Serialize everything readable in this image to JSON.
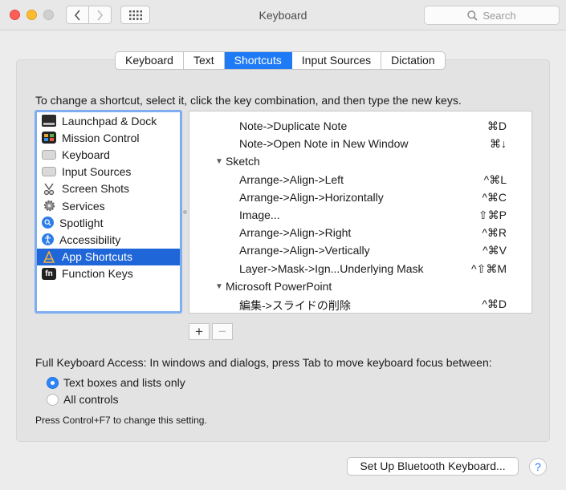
{
  "window": {
    "title": "Keyboard",
    "search_placeholder": "Search"
  },
  "tabs": [
    {
      "label": "Keyboard",
      "active": false
    },
    {
      "label": "Text",
      "active": false
    },
    {
      "label": "Shortcuts",
      "active": true
    },
    {
      "label": "Input Sources",
      "active": false
    },
    {
      "label": "Dictation",
      "active": false
    }
  ],
  "instruction": "To change a shortcut, select it, click the key combination, and then type the new keys.",
  "categories": [
    {
      "label": "Launchpad & Dock",
      "icon": "launchpad-dock-icon"
    },
    {
      "label": "Mission Control",
      "icon": "mission-control-icon"
    },
    {
      "label": "Keyboard",
      "icon": "keyboard-icon"
    },
    {
      "label": "Input Sources",
      "icon": "input-sources-icon"
    },
    {
      "label": "Screen Shots",
      "icon": "screenshot-icon"
    },
    {
      "label": "Services",
      "icon": "gear-icon"
    },
    {
      "label": "Spotlight",
      "icon": "spotlight-icon"
    },
    {
      "label": "Accessibility",
      "icon": "accessibility-icon"
    },
    {
      "label": "App Shortcuts",
      "icon": "app-shortcuts-icon",
      "selected": true
    },
    {
      "label": "Function Keys",
      "icon": "fn-key-icon"
    }
  ],
  "shortcuts": [
    {
      "type": "item",
      "name": "Note->Duplicate Note",
      "key": "⌘D"
    },
    {
      "type": "item",
      "name": "Note->Open Note in New Window",
      "key": "⌘↓"
    },
    {
      "type": "group",
      "name": "Sketch"
    },
    {
      "type": "item",
      "name": "Arrange->Align->Left",
      "key": "^⌘L"
    },
    {
      "type": "item",
      "name": "Arrange->Align->Horizontally",
      "key": "^⌘C"
    },
    {
      "type": "item",
      "name": "Image...",
      "key": "⇧⌘P"
    },
    {
      "type": "item",
      "name": "Arrange->Align->Right",
      "key": "^⌘R"
    },
    {
      "type": "item",
      "name": "Arrange->Align->Vertically",
      "key": "^⌘V"
    },
    {
      "type": "item",
      "name": "Layer->Mask->Ign...Underlying Mask",
      "key": "^⇧⌘M"
    },
    {
      "type": "group",
      "name": "Microsoft PowerPoint"
    },
    {
      "type": "item",
      "name": "編集->スライドの削除",
      "key": "^⌘D"
    }
  ],
  "controls": {
    "add_label": "+",
    "remove_label": "−"
  },
  "full_keyboard_access": {
    "label": "Full Keyboard Access: In windows and dialogs, press Tab to move keyboard focus between:",
    "options": [
      {
        "label": "Text boxes and lists only",
        "selected": true
      },
      {
        "label": "All controls",
        "selected": false
      }
    ],
    "note": "Press Control+F7 to change this setting."
  },
  "bluetooth_button": "Set Up Bluetooth Keyboard...",
  "help_label": "?"
}
